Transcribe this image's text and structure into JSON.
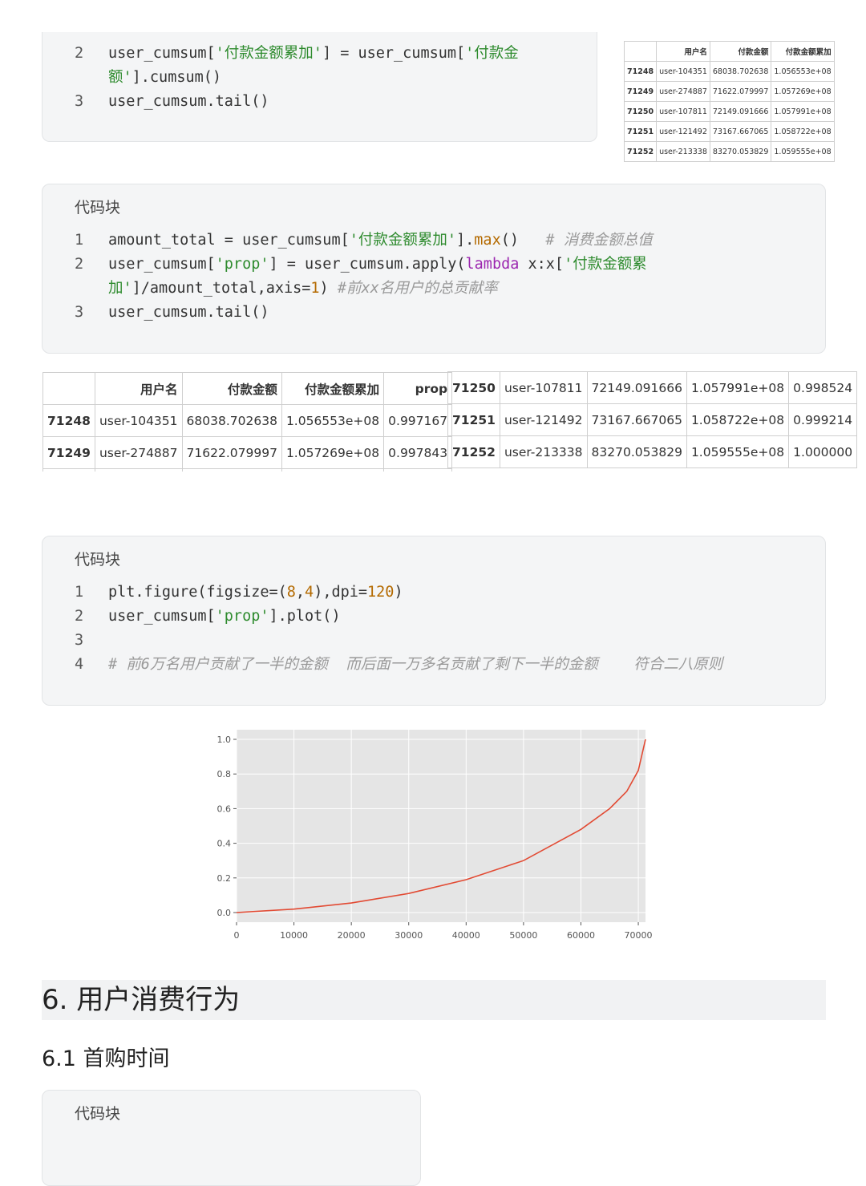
{
  "block1": {
    "lines": [
      {
        "num": "2",
        "parts": [
          [
            "p",
            "user_cumsum["
          ],
          [
            "s",
            "'付款金额累加'"
          ],
          [
            "p",
            "] = user_cumsum["
          ],
          [
            "s",
            "'付款金"
          ]
        ]
      },
      {
        "num": "",
        "parts": [
          [
            "s",
            "额'"
          ],
          [
            "p",
            "].cumsum()"
          ]
        ]
      },
      {
        "num": "3",
        "parts": [
          [
            "p",
            "user_cumsum.tail()"
          ]
        ]
      }
    ]
  },
  "table_small": {
    "headers": [
      "",
      "用户名",
      "付款金额",
      "付款金额累加"
    ],
    "rows": [
      [
        "71248",
        "user-104351",
        "68038.702638",
        "1.056553e+08"
      ],
      [
        "71249",
        "user-274887",
        "71622.079997",
        "1.057269e+08"
      ],
      [
        "71250",
        "user-107811",
        "72149.091666",
        "1.057991e+08"
      ],
      [
        "71251",
        "user-121492",
        "73167.667065",
        "1.058722e+08"
      ],
      [
        "71252",
        "user-213338",
        "83270.053829",
        "1.059555e+08"
      ]
    ]
  },
  "block2": {
    "title": "代码块",
    "lines": [
      {
        "num": "1",
        "parts": [
          [
            "p",
            "amount_total = user_cumsum["
          ],
          [
            "s",
            "'付款金额累加'"
          ],
          [
            "p",
            "]."
          ],
          [
            "f",
            "max"
          ],
          [
            "p",
            "()   "
          ],
          [
            "c",
            "# 消费金额总值"
          ]
        ]
      },
      {
        "num": "2",
        "parts": [
          [
            "p",
            "user_cumsum["
          ],
          [
            "s",
            "'prop'"
          ],
          [
            "p",
            "] = user_cumsum.apply("
          ],
          [
            "k",
            "lambda"
          ],
          [
            "p",
            " x:x["
          ],
          [
            "s",
            "'付款金额累"
          ]
        ]
      },
      {
        "num": "",
        "parts": [
          [
            "s",
            "加'"
          ],
          [
            "p",
            "]/amount_total,axis="
          ],
          [
            "n",
            "1"
          ],
          [
            "p",
            ") "
          ],
          [
            "c",
            "#前xx名用户的总贡献率"
          ]
        ]
      },
      {
        "num": "3",
        "parts": [
          [
            "p",
            "user_cumsum.tail()"
          ]
        ]
      }
    ]
  },
  "table_left": {
    "headers": [
      "",
      "用户名",
      "付款金额",
      "付款金额累加",
      "prop"
    ],
    "rows": [
      [
        "71248",
        "user-104351",
        "68038.702638",
        "1.056553e+08",
        "0.997167"
      ],
      [
        "71249",
        "user-274887",
        "71622.079997",
        "1.057269e+08",
        "0.997843"
      ]
    ]
  },
  "table_right": {
    "rows": [
      [
        "71250",
        "user-107811",
        "72149.091666",
        "1.057991e+08",
        "0.998524"
      ],
      [
        "71251",
        "user-121492",
        "73167.667065",
        "1.058722e+08",
        "0.999214"
      ],
      [
        "71252",
        "user-213338",
        "83270.053829",
        "1.059555e+08",
        "1.000000"
      ]
    ]
  },
  "block3": {
    "title": "代码块",
    "lines": [
      {
        "num": "1",
        "parts": [
          [
            "p",
            "plt.figure(figsize=("
          ],
          [
            "n",
            "8"
          ],
          [
            "p",
            ","
          ],
          [
            "n",
            "4"
          ],
          [
            "p",
            "),dpi="
          ],
          [
            "n",
            "120"
          ],
          [
            "p",
            ")"
          ]
        ]
      },
      {
        "num": "2",
        "parts": [
          [
            "p",
            "user_cumsum["
          ],
          [
            "s",
            "'prop'"
          ],
          [
            "p",
            "].plot()"
          ]
        ]
      },
      {
        "num": "3",
        "parts": []
      },
      {
        "num": "4",
        "parts": [
          [
            "c",
            "# 前6万名用户贡献了一半的金额  而后面一万多名贡献了剩下一半的金额    符合二八原则"
          ]
        ]
      }
    ]
  },
  "chart_data": {
    "type": "line",
    "series": [
      {
        "values": [
          [
            0,
            0.0
          ],
          [
            10000,
            0.02
          ],
          [
            20000,
            0.055
          ],
          [
            30000,
            0.11
          ],
          [
            40000,
            0.19
          ],
          [
            50000,
            0.3
          ],
          [
            60000,
            0.48
          ],
          [
            65000,
            0.6
          ],
          [
            68000,
            0.7
          ],
          [
            70000,
            0.82
          ],
          [
            71252,
            1.0
          ]
        ]
      }
    ],
    "xlim": [
      0,
      71252
    ],
    "ylim": [
      0,
      1.0
    ],
    "xticks": [
      "0",
      "10000",
      "20000",
      "30000",
      "40000",
      "50000",
      "60000",
      "70000"
    ],
    "yticks": [
      "0.0",
      "0.2",
      "0.4",
      "0.6",
      "0.8",
      "1.0"
    ],
    "grid": true,
    "colors": {
      "line": "#e24a33",
      "background": "#e5e5e5",
      "grid": "#ffffff"
    }
  },
  "heading1": "6. 用户消费行为",
  "heading2": "6.1 首购时间",
  "block4": {
    "title": "代码块"
  }
}
